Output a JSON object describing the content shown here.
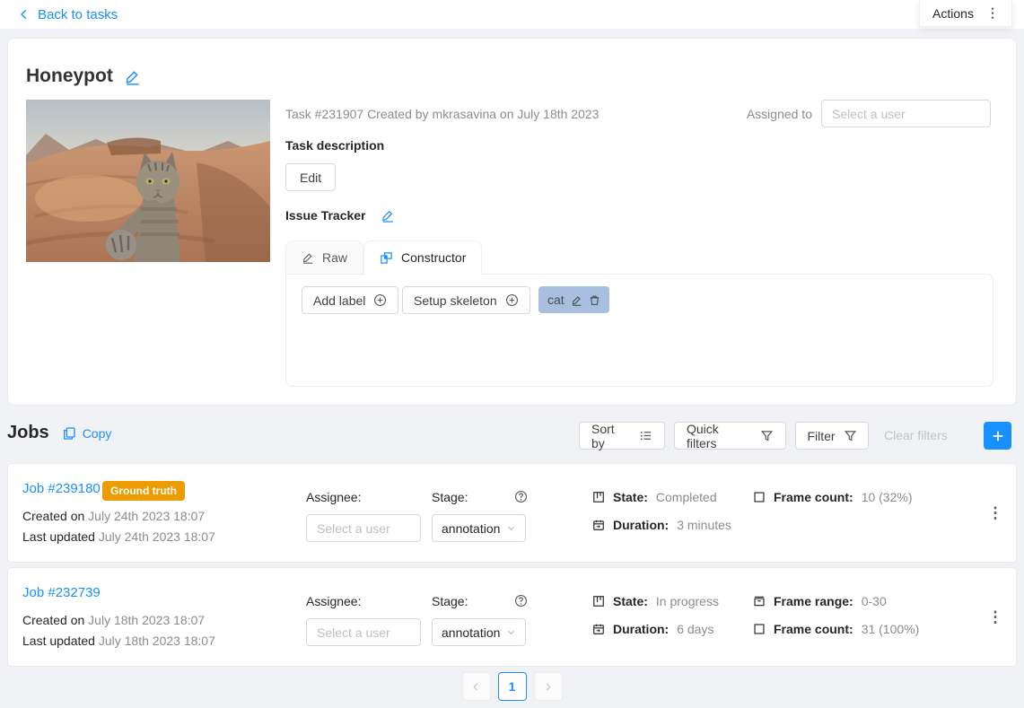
{
  "theme": {
    "accent": "#1890ff",
    "badge_orange": "#ED9C00",
    "chip_blue": "#a9bfe0"
  },
  "topbar": {
    "back_label": "Back to tasks",
    "actions_label": "Actions"
  },
  "task": {
    "title": "Honeypot",
    "meta": "Task #231907 Created by mkrasavina on July 18th 2023",
    "assigned_to_label": "Assigned to",
    "assignee_placeholder": "Select a user",
    "description_label": "Task description",
    "edit_button": "Edit",
    "issue_tracker_label": "Issue Tracker",
    "tab_raw_label": "Raw",
    "tab_constructor_label": "Constructor",
    "panel": {
      "add_label_button": "Add label",
      "setup_skeleton_button": "Setup skeleton",
      "labels": [
        {
          "name": "cat"
        }
      ]
    }
  },
  "jobs": {
    "title": "Jobs",
    "copy_label": "Copy",
    "toolbar": {
      "sort_by": "Sort by",
      "quick_filters": "Quick filters",
      "filter": "Filter",
      "clear_filters": "Clear filters"
    },
    "rows": [
      {
        "link": "Job #239180",
        "badge": "Ground truth",
        "created_label": "Created on",
        "created": "July 24th 2023 18:07",
        "updated_label": "Last updated",
        "updated": "July 24th 2023 18:07",
        "assignee_label": "Assignee:",
        "assignee_placeholder": "Select a user",
        "stage_label": "Stage:",
        "stage": "annotation",
        "state_label": "State:",
        "state": "Completed",
        "duration_label": "Duration:",
        "duration": "3 minutes",
        "frame_count_label": "Frame count:",
        "frame_count": "10 (32%)"
      },
      {
        "link": "Job #232739",
        "created_label": "Created on",
        "created": "July 18th 2023 18:07",
        "updated_label": "Last updated",
        "updated": "July 18th 2023 18:07",
        "assignee_label": "Assignee:",
        "assignee_placeholder": "Select a user",
        "stage_label": "Stage:",
        "stage": "annotation",
        "state_label": "State:",
        "state": "In progress",
        "duration_label": "Duration:",
        "duration": "6 days",
        "frame_range_label": "Frame range:",
        "frame_range": "0-30",
        "frame_count_label": "Frame count:",
        "frame_count": "31 (100%)"
      }
    ],
    "pagination": {
      "current_page": "1"
    },
    "icons": {
      "more_vertical": "⋮"
    }
  }
}
